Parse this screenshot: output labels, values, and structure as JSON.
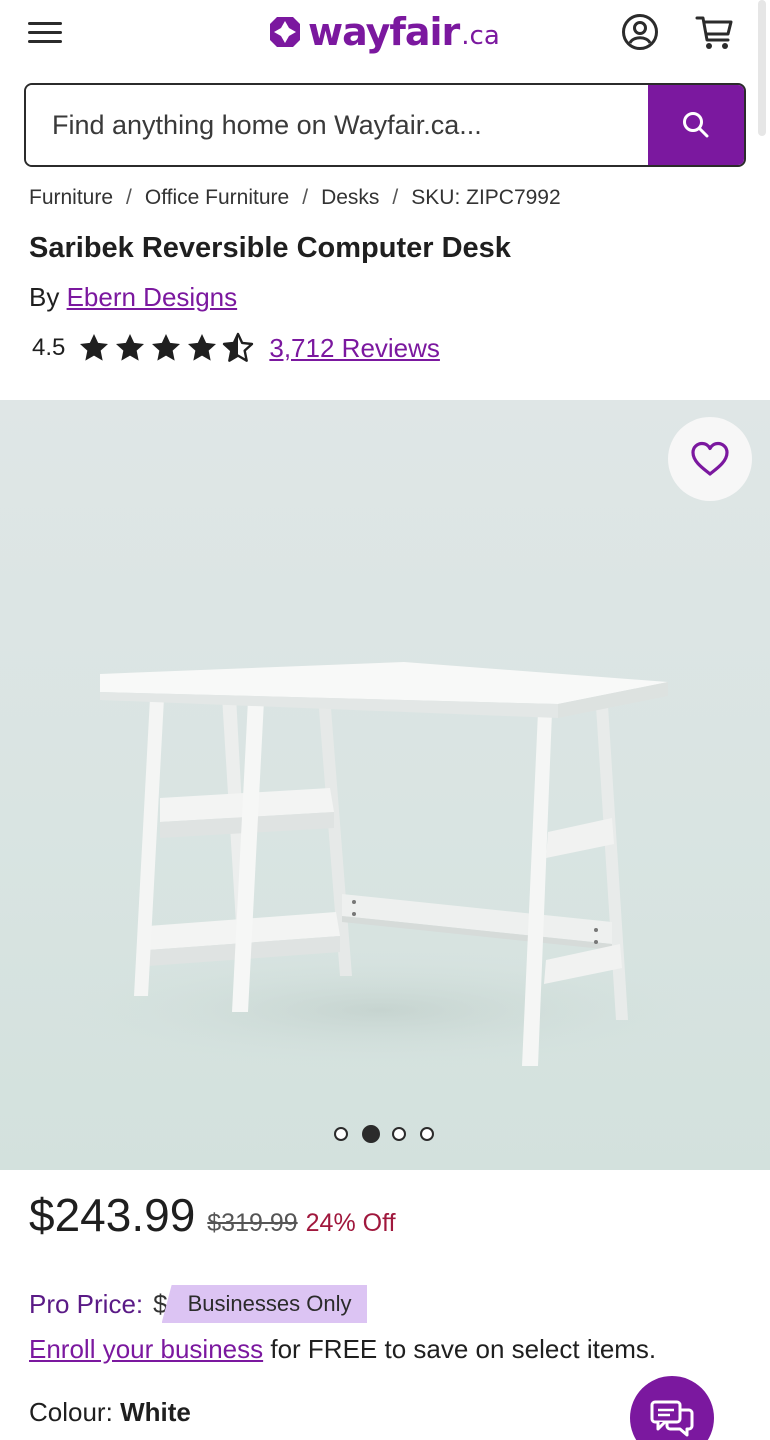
{
  "header": {
    "logo_text": "wayfair",
    "logo_suffix": ".ca",
    "icons": [
      "menu-icon",
      "account-icon",
      "cart-icon"
    ]
  },
  "search": {
    "placeholder": "Find anything home on Wayfair.ca...",
    "button_icon": "search-icon"
  },
  "breadcrumb": {
    "items": [
      "Furniture",
      "Office Furniture",
      "Desks"
    ],
    "separator": "/",
    "sku": "SKU: ZIPC7992"
  },
  "product": {
    "title": "Saribek Reversible Computer Desk",
    "by_label": "By",
    "brand": "Ebern Designs",
    "rating": "4.5",
    "rating_value": 4.5,
    "rating_max": 5,
    "reviews": "3,712 Reviews"
  },
  "gallery": {
    "total_images": 4,
    "active_index": 1,
    "favorite_icon": "heart-icon"
  },
  "pricing": {
    "price": "$243.99",
    "was_price": "$319.99",
    "discount": "24% Off",
    "pro_label": "Pro Price:",
    "pro_masked": "$",
    "pro_badge": "Businesses Only",
    "enroll_link": "Enroll your business",
    "enroll_rest": " for FREE to save on select items."
  },
  "options": {
    "colour_label": "Colour:",
    "colour_value": "White"
  },
  "colors": {
    "brand": "#7b189f",
    "discount": "#a0183d",
    "badge": "#dcc4f3"
  },
  "chat": {
    "icon": "chat-icon"
  }
}
